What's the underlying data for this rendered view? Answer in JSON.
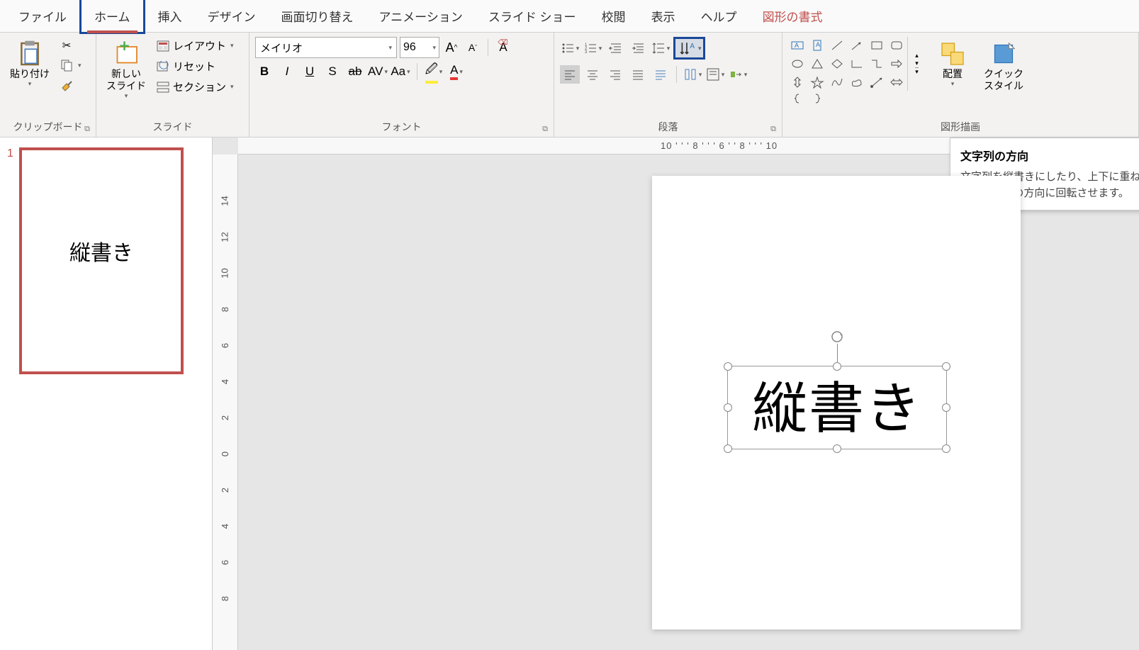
{
  "tabs": {
    "file": "ファイル",
    "home": "ホーム",
    "insert": "挿入",
    "design": "デザイン",
    "transitions": "画面切り替え",
    "animations": "アニメーション",
    "slideshow": "スライド ショー",
    "review": "校閲",
    "view": "表示",
    "help": "ヘルプ",
    "shapeformat": "図形の書式"
  },
  "groups": {
    "clipboard": {
      "label": "クリップボード",
      "paste": "貼り付け"
    },
    "slides": {
      "label": "スライド",
      "newslide": "新しい\nスライド",
      "layout": "レイアウト",
      "reset": "リセット",
      "section": "セクション"
    },
    "font": {
      "label": "フォント",
      "name": "メイリオ",
      "size": "96"
    },
    "paragraph": {
      "label": "段落"
    },
    "drawing": {
      "label": "図形描画",
      "arrange": "配置",
      "quickstyle": "クイック\nスタイル"
    }
  },
  "tooltip": {
    "title": "文字列の方向",
    "body": "文字列を縦書きにしたり、上下に重ねたり、希望の方向に回転させます。"
  },
  "ruler_h": "10 ' ' ' 8 ' ' ' 6                                                                                                                                                                                ' ' 8 ' ' ' 10",
  "ruler_v": [
    "14",
    "12",
    "10",
    "8",
    "6",
    "4",
    "2",
    "0",
    "2",
    "4",
    "6",
    "8"
  ],
  "slide": {
    "number": "1",
    "thumb_text": "縦書き",
    "textbox_text": "縦書き"
  }
}
